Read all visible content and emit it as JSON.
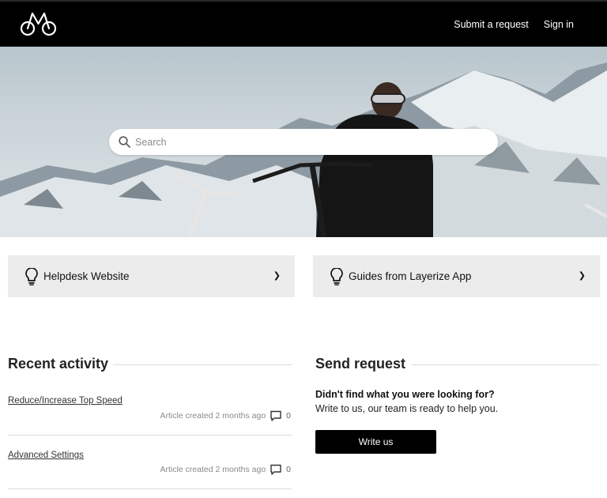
{
  "header": {
    "logo_icon": "bicycle-mountain-logo",
    "nav": {
      "submit_label": "Submit a request",
      "signin_label": "Sign in"
    }
  },
  "hero": {
    "search_placeholder": "Search",
    "search_icon": "search-icon"
  },
  "categories": [
    {
      "icon": "lightbulb-icon",
      "label": "Helpdesk Website",
      "chevron": "❯"
    },
    {
      "icon": "lightbulb-icon",
      "label": "Guides from Layerize App",
      "chevron": "❯"
    }
  ],
  "recent": {
    "title": "Recent activity",
    "items": [
      {
        "title": "Reduce/Increase Top Speed",
        "meta": "Article created 2 months ago",
        "comments": "0"
      },
      {
        "title": "Advanced Settings",
        "meta": "Article created 2 months ago",
        "comments": "0"
      }
    ]
  },
  "request": {
    "title": "Send request",
    "question": "Didn't find what you were looking for?",
    "text": "Write to us, our team is ready to help you.",
    "button_label": "Write us"
  },
  "colors": {
    "header_bg": "#000000",
    "card_bg": "#ececec",
    "button_bg": "#000000"
  }
}
